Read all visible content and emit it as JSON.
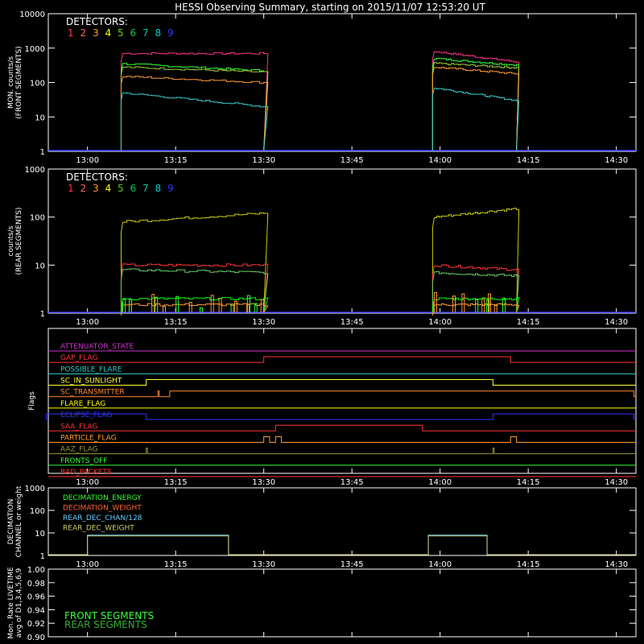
{
  "title": "HESSI Observing Summary, starting on 2015/11/07 12:53:20 UT",
  "colors": {
    "bg": "#000000",
    "axis": "#ffffff",
    "det": [
      "#ff3344",
      "#ff6666",
      "#ff9933",
      "#ffff00",
      "#66cc00",
      "#00cc44",
      "#00cc99",
      "#00cccc",
      "#3333ff"
    ],
    "front_lines": [
      "#ff3388",
      "#33ff33",
      "#99cc33",
      "#ff9933",
      "#33cccc",
      "#3333ff"
    ],
    "rear_lines": [
      "#cccc00",
      "#ff3333",
      "#66cc66",
      "#00ff00",
      "#ff9933",
      "#3333ff"
    ]
  },
  "time_ticks": [
    "13:00",
    "13:15",
    "13:30",
    "13:45",
    "14:00",
    "14:15",
    "14:30"
  ],
  "chart_data": [
    {
      "type": "line",
      "name": "front",
      "ylabel_lines": [
        "MON. counts/s",
        "(FRONT SEGMENTS)"
      ],
      "y_scale": "log",
      "ylim": [
        1,
        10000
      ],
      "y_ticks": [
        "10000",
        "1000",
        "100",
        "10",
        "1"
      ],
      "legend_title": "DETECTORS:",
      "legend_numbers": [
        "1",
        "2",
        "3",
        "4",
        "5",
        "6",
        "7",
        "8",
        "9"
      ],
      "time_range": [
        "12:53:20",
        "14:33:20"
      ],
      "intervals": [
        [
          "13:06",
          "13:30"
        ],
        [
          "13:59",
          "14:13"
        ]
      ],
      "series": [
        {
          "values_start": [
            700,
            800
          ],
          "values_end": [
            700,
            400
          ]
        },
        {
          "values_start": [
            350,
            500
          ],
          "values_end": [
            220,
            320
          ]
        },
        {
          "values_start": [
            280,
            360
          ],
          "values_end": [
            200,
            270
          ]
        },
        {
          "values_start": [
            150,
            280
          ],
          "values_end": [
            100,
            180
          ]
        },
        {
          "values_start": [
            50,
            70
          ],
          "values_end": [
            20,
            30
          ]
        },
        {
          "values_start": [
            1,
            1
          ],
          "values_end": [
            1,
            1
          ]
        }
      ]
    },
    {
      "type": "line",
      "name": "rear",
      "ylabel_lines": [
        "counts/s",
        "(REAR SEGMENTS)"
      ],
      "y_scale": "log",
      "ylim": [
        1,
        1000
      ],
      "y_ticks": [
        "1000",
        "100",
        "10",
        "1"
      ],
      "legend_title": "DETECTORS:",
      "legend_numbers": [
        "1",
        "2",
        "3",
        "4",
        "5",
        "6",
        "7",
        "8",
        "9"
      ],
      "time_range": [
        "12:53:20",
        "14:33:20"
      ],
      "intervals": [
        [
          "13:06",
          "13:30"
        ],
        [
          "13:59",
          "14:13"
        ]
      ],
      "series": [
        {
          "values_start": [
            80,
            100
          ],
          "values_end": [
            120,
            150
          ]
        },
        {
          "values_start": [
            10,
            10
          ],
          "values_end": [
            10,
            8
          ]
        },
        {
          "values_start": [
            8,
            7
          ],
          "values_end": [
            7,
            6
          ]
        },
        {
          "values_start": [
            2,
            2
          ],
          "values_end": [
            2,
            2
          ]
        },
        {
          "values_start": [
            1.5,
            1.5
          ],
          "values_end": [
            1.5,
            1.5
          ]
        },
        {
          "values_start": [
            1,
            1
          ],
          "values_end": [
            1,
            1
          ]
        }
      ]
    },
    {
      "type": "line",
      "name": "flags",
      "ylabel": "Flags",
      "flags": [
        {
          "label": "ATTENUATOR_STATE",
          "color": "#cc33cc",
          "high": []
        },
        {
          "label": "GAP_FLAG",
          "color": "#ff3333",
          "high": [
            [
              "13:30",
              "14:12"
            ]
          ]
        },
        {
          "label": "POSSIBLE_FLARE",
          "color": "#33cccc",
          "high": []
        },
        {
          "label": "SC_IN_SUNLIGHT",
          "color": "#ffff33",
          "high": [
            [
              "13:10",
              "14:09"
            ]
          ]
        },
        {
          "label": "SC_TRANSMITTER",
          "color": "#ff8833",
          "high": [
            [
              "13:12",
              "13:12"
            ],
            [
              "13:14",
              "14:33"
            ]
          ]
        },
        {
          "label": "FLARE_FLAG",
          "color": "#ffff00",
          "high": []
        },
        {
          "label": "ECLIPSE_FLAG",
          "color": "#3333ff",
          "high": [
            [
              "12:53",
              "13:10"
            ],
            [
              "14:09",
              "14:33"
            ]
          ]
        },
        {
          "label": "SAA_FLAG",
          "color": "#ff3333",
          "high": [
            [
              "13:32",
              "13:57"
            ]
          ]
        },
        {
          "label": "PARTICLE_FLAG",
          "color": "#ff9933",
          "high": [
            [
              "13:30",
              "13:31"
            ],
            [
              "13:32",
              "13:33"
            ],
            [
              "14:12",
              "14:13"
            ]
          ]
        },
        {
          "label": "AAZ_FLAG",
          "color": "#999933",
          "high": [
            [
              "13:10",
              "13:10"
            ],
            [
              "14:09",
              "14:09"
            ]
          ]
        },
        {
          "label": "FRONTS_OFF",
          "color": "#33ff33",
          "high": []
        },
        {
          "label": "BAD_PACKETS",
          "color": "#ff3333",
          "high": []
        }
      ]
    },
    {
      "type": "line",
      "name": "decimation",
      "ylabel_lines": [
        "DECIMATION",
        "CHANNEL or weight"
      ],
      "y_scale": "log",
      "ylim": [
        1,
        1000
      ],
      "y_ticks": [
        "1000",
        "100",
        "10",
        "1"
      ],
      "legend": [
        {
          "label": "DECIMATION_ENERGY",
          "color": "#33ff33"
        },
        {
          "label": "DECIMATION_WEIGHT",
          "color": "#ff6633"
        },
        {
          "label": "REAR_DEC_CHAN/128",
          "color": "#66ccff"
        },
        {
          "label": "REAR_DEC_WEIGHT",
          "color": "#cccc66"
        }
      ],
      "intervals": [
        [
          "13:00",
          "13:24"
        ],
        [
          "13:58",
          "14:08"
        ]
      ],
      "level": 8
    },
    {
      "type": "line",
      "name": "livetime",
      "ylabel_lines": [
        "Mon. Rate LIVETIME",
        "avg of D1,3,4,5,6,9"
      ],
      "ylim": [
        0.9,
        1.0
      ],
      "y_ticks": [
        "1.00",
        "0.98",
        "0.96",
        "0.94",
        "0.92",
        "0.90"
      ],
      "legend": [
        {
          "label": "FRONT SEGMENTS",
          "color": "#33ff33"
        },
        {
          "label": "REAR SEGMENTS",
          "color": "#33aa33"
        }
      ]
    }
  ]
}
